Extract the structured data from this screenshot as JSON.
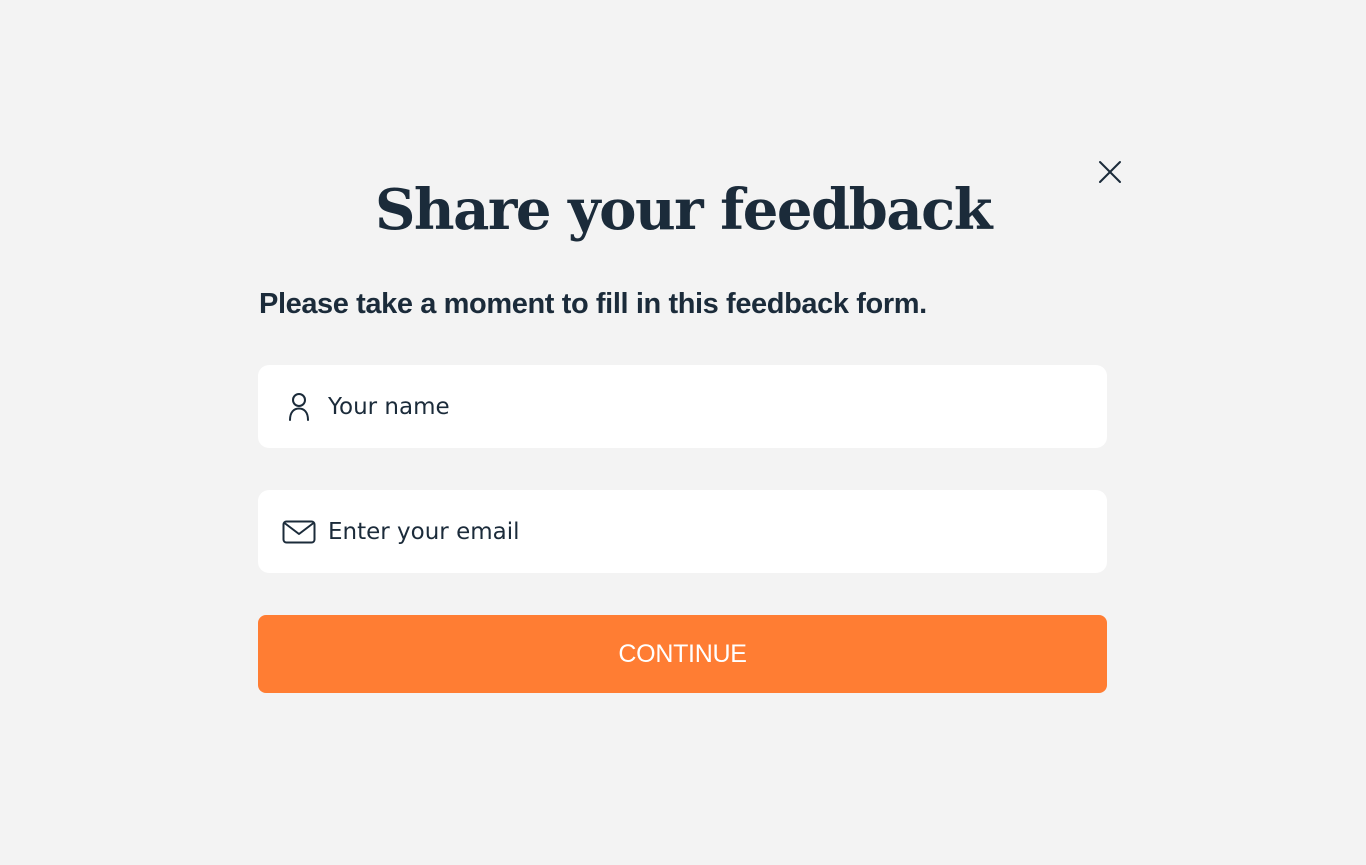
{
  "dialog": {
    "title": "Share your feedback",
    "subtitle": "Please take a moment to fill in this feedback form.",
    "close_icon": "close-icon"
  },
  "form": {
    "name_field": {
      "icon": "user-icon",
      "placeholder": "Your name",
      "value": ""
    },
    "email_field": {
      "icon": "mail-icon",
      "placeholder": "Enter your email",
      "value": ""
    },
    "continue_label": "CONTINUE"
  },
  "colors": {
    "background": "#f3f3f3",
    "text": "#1b2b3a",
    "accent": "#ff7d33",
    "field_bg": "#ffffff"
  }
}
